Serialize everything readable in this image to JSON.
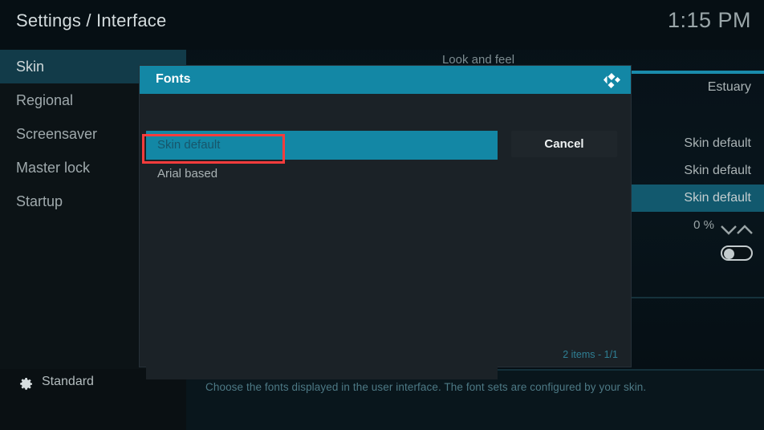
{
  "header": {
    "title": "Settings / Interface",
    "clock": "1:15 PM"
  },
  "sidebar": {
    "items": [
      {
        "label": "Skin",
        "selected": true
      },
      {
        "label": "Regional",
        "selected": false
      },
      {
        "label": "Screensaver",
        "selected": false
      },
      {
        "label": "Master lock",
        "selected": false
      },
      {
        "label": "Startup",
        "selected": false
      }
    ]
  },
  "level_button": {
    "icon": "gear-icon",
    "label": "Standard"
  },
  "main": {
    "section_header": "Look and feel",
    "values": [
      {
        "text": "Estuary",
        "highlighted": false
      },
      {
        "text": "Skin default",
        "highlighted": false
      },
      {
        "text": "Skin default",
        "highlighted": false
      },
      {
        "text": "Skin default",
        "highlighted": true
      }
    ],
    "zoom": {
      "value": "0 %",
      "down_icon": "chevron-down-icon",
      "up_icon": "chevron-up-icon"
    },
    "toggle": {
      "state": "off"
    }
  },
  "help": {
    "text": "Choose the fonts displayed in the user interface. The font sets are configured by your skin."
  },
  "dialog": {
    "title": "Fonts",
    "logo": "kodi-logo",
    "options": [
      {
        "label": "Skin default",
        "selected": true
      },
      {
        "label": "Arial based",
        "selected": false
      }
    ],
    "cancel_label": "Cancel",
    "item_count": "2 items - 1/1"
  },
  "annotation": {
    "target": "Arial based",
    "color": "#fa3c3c"
  },
  "colors": {
    "accent": "#1387a5",
    "sidebar_selected": "#123b49",
    "row_highlight": "#12596e",
    "annotation": "#fa3c3c",
    "help_text": "#4d7985"
  }
}
